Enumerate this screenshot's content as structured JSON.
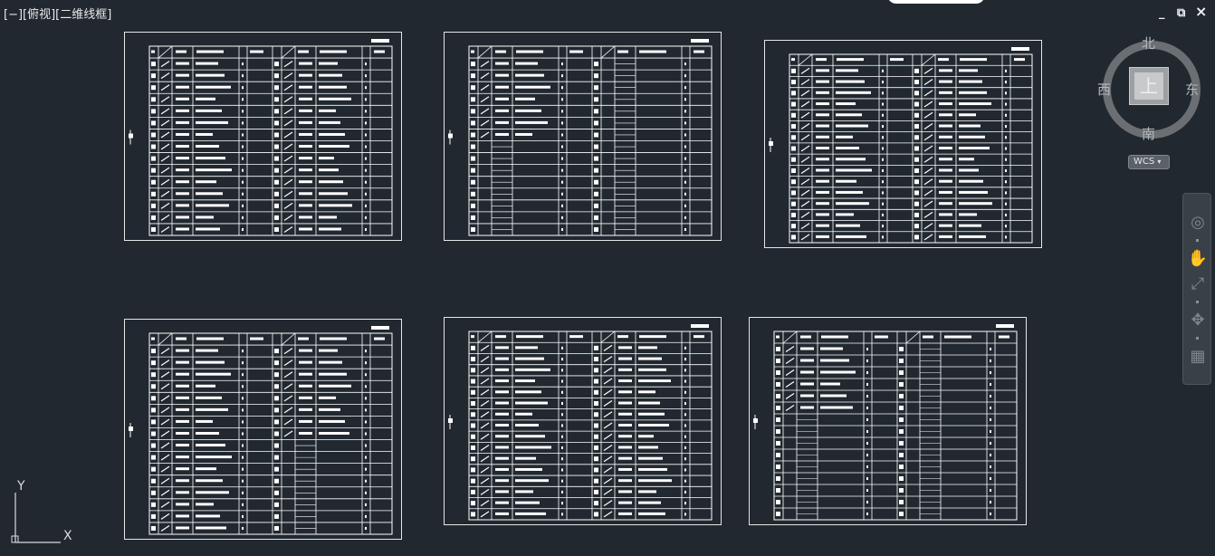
{
  "viewport": {
    "label": "[−][俯视][二维线框]",
    "window_controls": {
      "minimize": "_",
      "restore": "⧉",
      "close": "×"
    }
  },
  "viewcube": {
    "north": "北",
    "south": "南",
    "east": "东",
    "west": "西",
    "face": "上",
    "ucs_label": "WCS"
  },
  "navigation_bar": {
    "tools": [
      "full-navigation-wheel",
      "pan",
      "zoom-extents",
      "orbit",
      "showmotion"
    ]
  },
  "ucs_icon": {
    "y_label": "Y",
    "x_label": "X"
  },
  "sheets": [
    {
      "id": "sheet-1",
      "rows": 15,
      "left_filled": 15,
      "right_filled": 15
    },
    {
      "id": "sheet-2",
      "rows": 15,
      "left_filled": 7,
      "right_filled": 0
    },
    {
      "id": "sheet-3",
      "rows": 16,
      "left_filled": 16,
      "right_filled": 16
    },
    {
      "id": "sheet-4",
      "rows": 16,
      "left_filled": 16,
      "right_filled": 8
    },
    {
      "id": "sheet-5",
      "rows": 16,
      "left_filled": 16,
      "right_filled": 16
    },
    {
      "id": "sheet-6",
      "rows": 15,
      "left_filled": 6,
      "right_filled": 0
    }
  ],
  "colors": {
    "background": "#212830",
    "linework": "#ffffff"
  }
}
